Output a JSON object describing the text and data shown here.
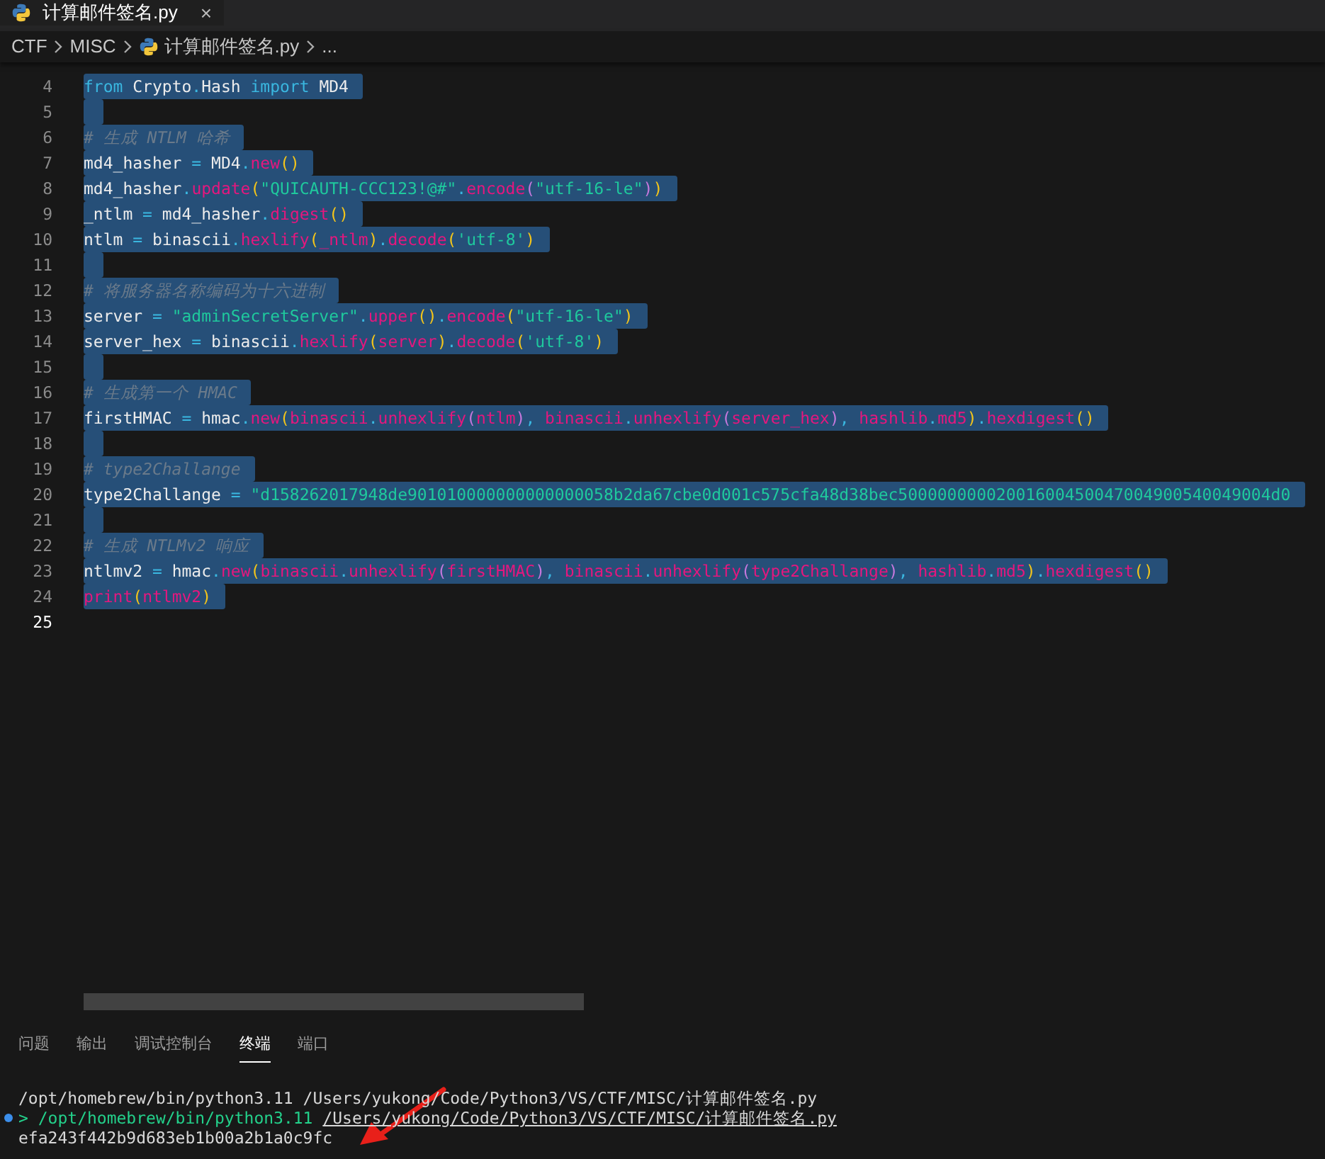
{
  "editor_tab": {
    "title": "计算邮件签名.py",
    "close": "×",
    "selected": true
  },
  "breadcrumbs": [
    "CTF",
    "MISC",
    "计算邮件签名.py",
    "..."
  ],
  "code_lines": [
    {
      "number": "4",
      "selected": true,
      "tokens": [
        {
          "text": "from",
          "kind": "kw"
        },
        {
          "text": " Crypto",
          "kind": "id"
        },
        {
          "text": ".",
          "kind": "op"
        },
        {
          "text": "Hash ",
          "kind": "id"
        },
        {
          "text": "import",
          "kind": "kw"
        },
        {
          "text": " MD4",
          "kind": "id"
        }
      ]
    },
    {
      "number": "5",
      "selected": true
    },
    {
      "number": "6",
      "selected": true,
      "tokens": [
        {
          "text": "# 生成 NTLM 哈希",
          "kind": "cm"
        }
      ]
    },
    {
      "number": "7",
      "selected": true,
      "tokens": [
        {
          "text": "md4_hasher ",
          "kind": "id"
        },
        {
          "text": "=",
          "kind": "op"
        },
        {
          "text": " MD4",
          "kind": "id"
        },
        {
          "text": ".",
          "kind": "op"
        },
        {
          "text": "new",
          "kind": "fn"
        },
        {
          "text": "()",
          "kind": "br1"
        }
      ]
    },
    {
      "number": "8",
      "selected": true,
      "tokens": [
        {
          "text": "md4_hasher",
          "kind": "id"
        },
        {
          "text": ".",
          "kind": "op"
        },
        {
          "text": "update",
          "kind": "fn"
        },
        {
          "text": "(",
          "kind": "br1"
        },
        {
          "text": "\"QUICAUTH-CCC123!@#\"",
          "kind": "str"
        },
        {
          "text": ".",
          "kind": "op"
        },
        {
          "text": "encode",
          "kind": "fn"
        },
        {
          "text": "(",
          "kind": "br2"
        },
        {
          "text": "\"utf-16-le\"",
          "kind": "str"
        },
        {
          "text": ")",
          "kind": "br2"
        },
        {
          "text": ")",
          "kind": "br1"
        }
      ]
    },
    {
      "number": "9",
      "selected": true,
      "tokens": [
        {
          "text": "_ntlm ",
          "kind": "id"
        },
        {
          "text": "=",
          "kind": "op"
        },
        {
          "text": " md4_hasher",
          "kind": "id"
        },
        {
          "text": ".",
          "kind": "op"
        },
        {
          "text": "digest",
          "kind": "fn"
        },
        {
          "text": "()",
          "kind": "br1"
        }
      ]
    },
    {
      "number": "10",
      "selected": true,
      "tokens": [
        {
          "text": "ntlm ",
          "kind": "id"
        },
        {
          "text": "=",
          "kind": "op"
        },
        {
          "text": " binascii",
          "kind": "id"
        },
        {
          "text": ".",
          "kind": "op"
        },
        {
          "text": "hexlify",
          "kind": "fn"
        },
        {
          "text": "(",
          "kind": "br1"
        },
        {
          "text": "_ntlm",
          "kind": "fn"
        },
        {
          "text": ")",
          "kind": "br1"
        },
        {
          "text": ".",
          "kind": "op"
        },
        {
          "text": "decode",
          "kind": "fn"
        },
        {
          "text": "(",
          "kind": "br1"
        },
        {
          "text": "'utf-8'",
          "kind": "str"
        },
        {
          "text": ")",
          "kind": "br1"
        }
      ]
    },
    {
      "number": "11",
      "selected": true
    },
    {
      "number": "12",
      "selected": true,
      "tokens": [
        {
          "text": "# 将服务器名称编码为十六进制",
          "kind": "cm"
        }
      ]
    },
    {
      "number": "13",
      "selected": true,
      "tokens": [
        {
          "text": "server ",
          "kind": "id"
        },
        {
          "text": "=",
          "kind": "op"
        },
        {
          "text": " \"adminSecretServer\"",
          "kind": "str"
        },
        {
          "text": ".",
          "kind": "op"
        },
        {
          "text": "upper",
          "kind": "fn"
        },
        {
          "text": "()",
          "kind": "br1"
        },
        {
          "text": ".",
          "kind": "op"
        },
        {
          "text": "encode",
          "kind": "fn"
        },
        {
          "text": "(",
          "kind": "br1"
        },
        {
          "text": "\"utf-16-le\"",
          "kind": "str"
        },
        {
          "text": ")",
          "kind": "br1"
        }
      ]
    },
    {
      "number": "14",
      "selected": true,
      "tokens": [
        {
          "text": "server_hex ",
          "kind": "id"
        },
        {
          "text": "=",
          "kind": "op"
        },
        {
          "text": " binascii",
          "kind": "id"
        },
        {
          "text": ".",
          "kind": "op"
        },
        {
          "text": "hexlify",
          "kind": "fn"
        },
        {
          "text": "(",
          "kind": "br1"
        },
        {
          "text": "server",
          "kind": "fn"
        },
        {
          "text": ")",
          "kind": "br1"
        },
        {
          "text": ".",
          "kind": "op"
        },
        {
          "text": "decode",
          "kind": "fn"
        },
        {
          "text": "(",
          "kind": "br1"
        },
        {
          "text": "'utf-8'",
          "kind": "str"
        },
        {
          "text": ")",
          "kind": "br1"
        }
      ]
    },
    {
      "number": "15",
      "selected": true
    },
    {
      "number": "16",
      "selected": true,
      "tokens": [
        {
          "text": "# 生成第一个 HMAC",
          "kind": "cm"
        }
      ]
    },
    {
      "number": "17",
      "selected": true,
      "tokens": [
        {
          "text": "firstHMAC ",
          "kind": "id"
        },
        {
          "text": "=",
          "kind": "op"
        },
        {
          "text": " hmac",
          "kind": "id"
        },
        {
          "text": ".",
          "kind": "op"
        },
        {
          "text": "new",
          "kind": "fn"
        },
        {
          "text": "(",
          "kind": "br1"
        },
        {
          "text": "binascii",
          "kind": "fn"
        },
        {
          "text": ".",
          "kind": "op"
        },
        {
          "text": "unhexlify",
          "kind": "fn"
        },
        {
          "text": "(",
          "kind": "br2"
        },
        {
          "text": "ntlm",
          "kind": "fn"
        },
        {
          "text": ")",
          "kind": "br2"
        },
        {
          "text": ", ",
          "kind": "op"
        },
        {
          "text": "binascii",
          "kind": "fn"
        },
        {
          "text": ".",
          "kind": "op"
        },
        {
          "text": "unhexlify",
          "kind": "fn"
        },
        {
          "text": "(",
          "kind": "br2"
        },
        {
          "text": "server_hex",
          "kind": "fn"
        },
        {
          "text": ")",
          "kind": "br2"
        },
        {
          "text": ", ",
          "kind": "op"
        },
        {
          "text": "hashlib",
          "kind": "fn"
        },
        {
          "text": ".",
          "kind": "op"
        },
        {
          "text": "md5",
          "kind": "fn"
        },
        {
          "text": ")",
          "kind": "br1"
        },
        {
          "text": ".",
          "kind": "op"
        },
        {
          "text": "hexdigest",
          "kind": "fn"
        },
        {
          "text": "()",
          "kind": "br1"
        }
      ]
    },
    {
      "number": "18",
      "selected": true
    },
    {
      "number": "19",
      "selected": true,
      "tokens": [
        {
          "text": "# type2Challange",
          "kind": "cm"
        }
      ]
    },
    {
      "number": "20",
      "selected": true,
      "tokens": [
        {
          "text": "type2Challange ",
          "kind": "id"
        },
        {
          "text": "=",
          "kind": "op"
        },
        {
          "text": " \"d158262017948de901010000000000000058b2da67cbe0d001c575cfa48d38bec50000000002001600450047004900540049004d0",
          "kind": "str"
        }
      ]
    },
    {
      "number": "21",
      "selected": true
    },
    {
      "number": "22",
      "selected": true,
      "tokens": [
        {
          "text": "# 生成 NTLMv2 响应",
          "kind": "cm"
        }
      ]
    },
    {
      "number": "23",
      "selected": true,
      "tokens": [
        {
          "text": "ntlmv2 ",
          "kind": "id"
        },
        {
          "text": "=",
          "kind": "op"
        },
        {
          "text": " hmac",
          "kind": "id"
        },
        {
          "text": ".",
          "kind": "op"
        },
        {
          "text": "new",
          "kind": "fn"
        },
        {
          "text": "(",
          "kind": "br1"
        },
        {
          "text": "binascii",
          "kind": "fn"
        },
        {
          "text": ".",
          "kind": "op"
        },
        {
          "text": "unhexlify",
          "kind": "fn"
        },
        {
          "text": "(",
          "kind": "br2"
        },
        {
          "text": "firstHMAC",
          "kind": "fn"
        },
        {
          "text": ")",
          "kind": "br2"
        },
        {
          "text": ", ",
          "kind": "op"
        },
        {
          "text": "binascii",
          "kind": "fn"
        },
        {
          "text": ".",
          "kind": "op"
        },
        {
          "text": "unhexlify",
          "kind": "fn"
        },
        {
          "text": "(",
          "kind": "br2"
        },
        {
          "text": "type2Challange",
          "kind": "fn"
        },
        {
          "text": ")",
          "kind": "br2"
        },
        {
          "text": ", ",
          "kind": "op"
        },
        {
          "text": "hashlib",
          "kind": "fn"
        },
        {
          "text": ".",
          "kind": "op"
        },
        {
          "text": "md5",
          "kind": "fn"
        },
        {
          "text": ")",
          "kind": "br1"
        },
        {
          "text": ".",
          "kind": "op"
        },
        {
          "text": "hexdigest",
          "kind": "fn"
        },
        {
          "text": "()",
          "kind": "br1"
        }
      ]
    },
    {
      "number": "24",
      "selected": true,
      "tokens": [
        {
          "text": "print",
          "kind": "fn"
        },
        {
          "text": "(",
          "kind": "br1"
        },
        {
          "text": "ntlmv2",
          "kind": "fn"
        },
        {
          "text": ")",
          "kind": "br1"
        }
      ]
    },
    {
      "number": "25",
      "selected": false
    }
  ],
  "panel_tabs": [
    {
      "label": "问题",
      "selected": false
    },
    {
      "label": "输出",
      "selected": false
    },
    {
      "label": "调试控制台",
      "selected": false
    },
    {
      "label": "终端",
      "selected": true
    },
    {
      "label": "端口",
      "selected": false
    }
  ],
  "terminal_lines": [
    {
      "kind": "plain",
      "text": "/opt/homebrew/bin/python3.11 /Users/yukong/Code/Python3/VS/CTF/MISC/计算邮件签名.py"
    },
    {
      "kind": "command",
      "prompt": ">",
      "command": "/opt/homebrew/bin/python3.11",
      "argument": "/Users/yukong/Code/Python3/VS/CTF/MISC/计算邮件签名.py"
    },
    {
      "kind": "plain",
      "text": "efa243f442b9d683eb1b00a2b1a0c9fc"
    }
  ]
}
